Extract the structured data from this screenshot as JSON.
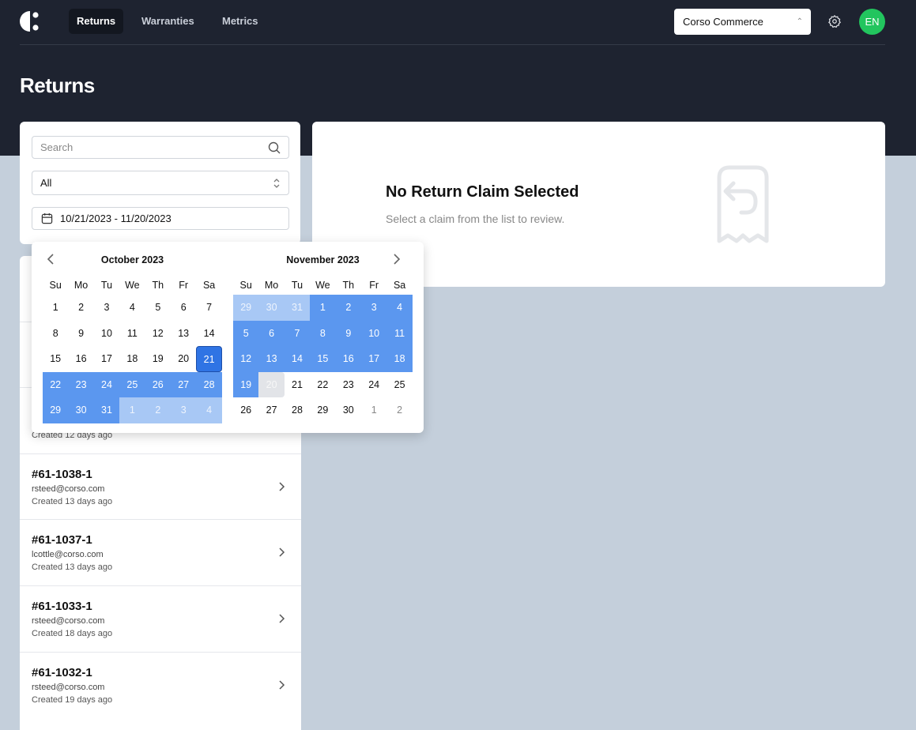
{
  "header": {
    "nav": [
      {
        "label": "Returns",
        "active": true
      },
      {
        "label": "Warranties"
      },
      {
        "label": "Metrics"
      }
    ],
    "store": "Corso Commerce",
    "avatar": "EN",
    "avatar_color": "#22c55e"
  },
  "page_title": "Returns",
  "filters": {
    "search_placeholder": "Search",
    "status": "All",
    "date_range": "10/21/2023 - 11/20/2023"
  },
  "calendar": {
    "months": [
      {
        "title": "October 2023"
      },
      {
        "title": "November 2023"
      }
    ],
    "weekdays": [
      "Su",
      "Mo",
      "Tu",
      "We",
      "Th",
      "Fr",
      "Sa"
    ],
    "range_start": "10/21/2023",
    "range_end": "11/20/2023",
    "accent": "#5b97ef"
  },
  "list": [
    {
      "id": "",
      "email": "",
      "created": ""
    },
    {
      "id": "",
      "email": "",
      "created": ""
    },
    {
      "id": "",
      "email": "",
      "created": "Created 12 days ago"
    },
    {
      "id": "#61-1038-1",
      "email": "rsteed@corso.com",
      "created": "Created 13 days ago"
    },
    {
      "id": "#61-1037-1",
      "email": "lcottle@corso.com",
      "created": "Created 13 days ago"
    },
    {
      "id": "#61-1033-1",
      "email": "rsteed@corso.com",
      "created": "Created 18 days ago"
    },
    {
      "id": "#61-1032-1",
      "email": "rsteed@corso.com",
      "created": "Created 19 days ago"
    }
  ],
  "empty_state": {
    "title": "No Return Claim Selected",
    "subtitle": "Select a claim from the list to review.",
    "icon": "receipt-return-icon"
  }
}
